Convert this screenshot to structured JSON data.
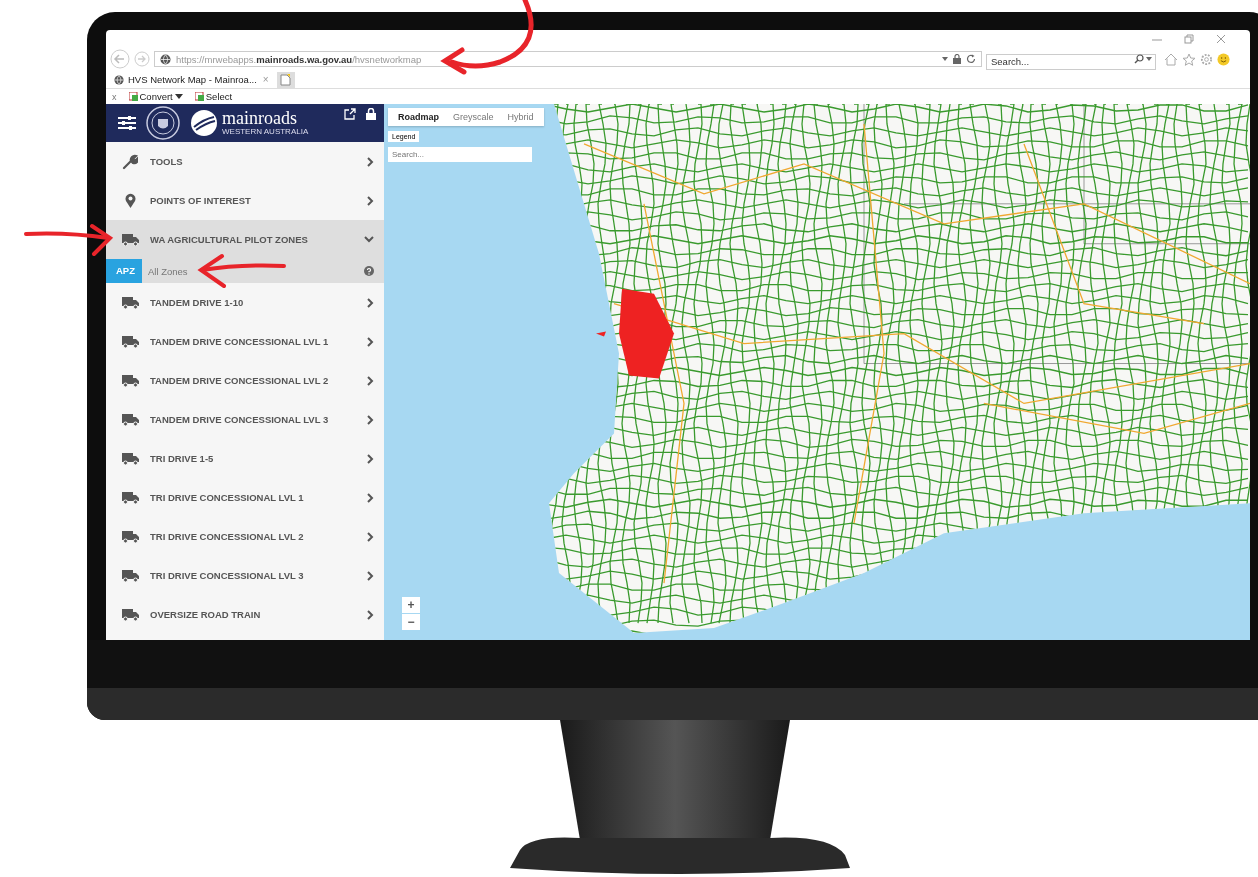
{
  "browser": {
    "url": "https://mrwebapps.**mainroads.wa.gov.au**/hvsnetworkmap",
    "search": {
      "placeholder": "Search..."
    },
    "tab": {
      "title": "HVS Network Map - Mainroa...",
      "close": "×"
    },
    "commands": [
      {
        "label": "Convert",
        "kind": "dropdown"
      },
      {
        "label": "Select",
        "kind": "plain"
      }
    ],
    "command_close": "x"
  },
  "sidebar": {
    "logo": {
      "name": "mainroads",
      "tagline": "WESTERN AUSTRALIA"
    },
    "items": [
      {
        "label": "TOOLS",
        "kind": "tool",
        "expanded": false
      },
      {
        "label": "POINTS OF INTEREST",
        "kind": "place",
        "expanded": false
      },
      {
        "label": "WA AGRICULTURAL PILOT ZONES",
        "kind": "vehicle",
        "expanded": true,
        "children": [
          {
            "badge": "APZ",
            "label": "All Zones"
          }
        ]
      },
      {
        "label": "TANDEM DRIVE 1-10",
        "kind": "vehicle",
        "expanded": false
      },
      {
        "label": "TANDEM DRIVE CONCESSIONAL LVL 1",
        "kind": "vehicle",
        "expanded": false
      },
      {
        "label": "TANDEM DRIVE CONCESSIONAL LVL 2",
        "kind": "vehicle",
        "expanded": false
      },
      {
        "label": "TANDEM DRIVE CONCESSIONAL LVL 3",
        "kind": "vehicle",
        "expanded": false
      },
      {
        "label": "TRI DRIVE 1-5",
        "kind": "vehicle",
        "expanded": false
      },
      {
        "label": "TRI DRIVE CONCESSIONAL LVL 1",
        "kind": "vehicle",
        "expanded": false
      },
      {
        "label": "TRI DRIVE CONCESSIONAL LVL 2",
        "kind": "vehicle",
        "expanded": false
      },
      {
        "label": "TRI DRIVE CONCESSIONAL LVL 3",
        "kind": "vehicle",
        "expanded": false
      },
      {
        "label": "OVERSIZE ROAD TRAIN",
        "kind": "vehicle",
        "expanded": false
      }
    ]
  },
  "map": {
    "tabs": [
      {
        "label": "Roadmap",
        "selected": true
      },
      {
        "label": "Greyscale",
        "selected": false
      },
      {
        "label": "Hybrid",
        "selected": false
      }
    ],
    "legend": "Legend",
    "search": {
      "placeholder": "Search..."
    },
    "zoom": [
      "+",
      "−"
    ]
  }
}
